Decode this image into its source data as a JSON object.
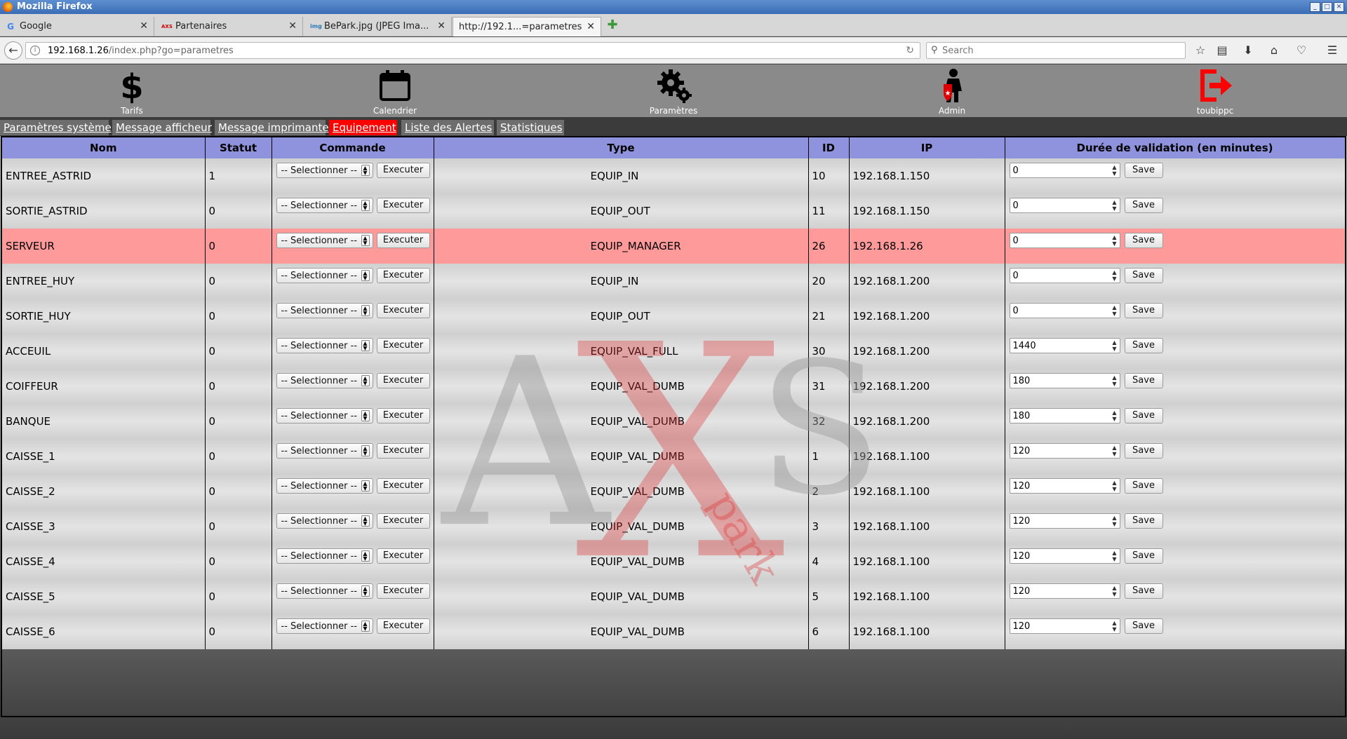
{
  "window": {
    "title": "Mozilla Firefox"
  },
  "tabs": [
    {
      "label": "Google",
      "icon": "G"
    },
    {
      "label": "Partenaires",
      "icon": "AXS"
    },
    {
      "label": "BePark.jpg (JPEG Ima...",
      "icon": "img"
    },
    {
      "label": "http://192.1...=parametres",
      "icon": ""
    }
  ],
  "urlbar": {
    "host": "192.168.1.26",
    "path": "/index.php?go=parametres"
  },
  "search": {
    "placeholder": "Search"
  },
  "menu": [
    {
      "label": "Tarifs",
      "icon": "dollar-icon"
    },
    {
      "label": "Calendrier",
      "icon": "calendar-icon"
    },
    {
      "label": "Paramètres",
      "icon": "gears-icon"
    },
    {
      "label": "Admin",
      "icon": "admin-icon"
    },
    {
      "label": "toubippc",
      "icon": "logout-icon",
      "color": "#ff0000"
    }
  ],
  "subnav": [
    {
      "label": "Paramètres système",
      "active": false
    },
    {
      "label": "Message afficheur",
      "active": false
    },
    {
      "label": "Message imprimante",
      "active": false
    },
    {
      "label": "Equipement",
      "active": true
    },
    {
      "label": "Liste des Alertes",
      "active": false
    },
    {
      "label": "Statistiques",
      "active": false
    }
  ],
  "table": {
    "headers": {
      "nom": "Nom",
      "statut": "Statut",
      "commande": "Commande",
      "type": "Type",
      "id": "ID",
      "ip": "IP",
      "duree": "Durée de validation (en minutes)"
    },
    "select_label": "-- Selectionner --",
    "execute_label": "Executer",
    "save_label": "Save",
    "alert_color": "#ff9a9a",
    "rows": [
      {
        "nom": "ENTREE_ASTRID",
        "statut": "1",
        "type": "EQUIP_IN",
        "id": "10",
        "ip": "192.168.1.150",
        "duree": "0",
        "alert": false
      },
      {
        "nom": "SORTIE_ASTRID",
        "statut": "0",
        "type": "EQUIP_OUT",
        "id": "11",
        "ip": "192.168.1.150",
        "duree": "0",
        "alert": false
      },
      {
        "nom": "SERVEUR",
        "statut": "0",
        "type": "EQUIP_MANAGER",
        "id": "26",
        "ip": "192.168.1.26",
        "duree": "0",
        "alert": true
      },
      {
        "nom": "ENTREE_HUY",
        "statut": "0",
        "type": "EQUIP_IN",
        "id": "20",
        "ip": "192.168.1.200",
        "duree": "0",
        "alert": false
      },
      {
        "nom": "SORTIE_HUY",
        "statut": "0",
        "type": "EQUIP_OUT",
        "id": "21",
        "ip": "192.168.1.200",
        "duree": "0",
        "alert": false
      },
      {
        "nom": "ACCEUIL",
        "statut": "0",
        "type": "EQUIP_VAL_FULL",
        "id": "30",
        "ip": "192.168.1.200",
        "duree": "1440",
        "alert": false
      },
      {
        "nom": "COIFFEUR",
        "statut": "0",
        "type": "EQUIP_VAL_DUMB",
        "id": "31",
        "ip": "192.168.1.200",
        "duree": "180",
        "alert": false
      },
      {
        "nom": "BANQUE",
        "statut": "0",
        "type": "EQUIP_VAL_DUMB",
        "id": "32",
        "ip": "192.168.1.200",
        "duree": "180",
        "alert": false
      },
      {
        "nom": "CAISSE_1",
        "statut": "0",
        "type": "EQUIP_VAL_DUMB",
        "id": "1",
        "ip": "192.168.1.100",
        "duree": "120",
        "alert": false
      },
      {
        "nom": "CAISSE_2",
        "statut": "0",
        "type": "EQUIP_VAL_DUMB",
        "id": "2",
        "ip": "192.168.1.100",
        "duree": "120",
        "alert": false
      },
      {
        "nom": "CAISSE_3",
        "statut": "0",
        "type": "EQUIP_VAL_DUMB",
        "id": "3",
        "ip": "192.168.1.100",
        "duree": "120",
        "alert": false
      },
      {
        "nom": "CAISSE_4",
        "statut": "0",
        "type": "EQUIP_VAL_DUMB",
        "id": "4",
        "ip": "192.168.1.100",
        "duree": "120",
        "alert": false
      },
      {
        "nom": "CAISSE_5",
        "statut": "0",
        "type": "EQUIP_VAL_DUMB",
        "id": "5",
        "ip": "192.168.1.100",
        "duree": "120",
        "alert": false
      },
      {
        "nom": "CAISSE_6",
        "statut": "0",
        "type": "EQUIP_VAL_DUMB",
        "id": "6",
        "ip": "192.168.1.100",
        "duree": "120",
        "alert": false
      }
    ]
  },
  "watermark": {
    "letters": "AXS",
    "subtext": "park"
  }
}
